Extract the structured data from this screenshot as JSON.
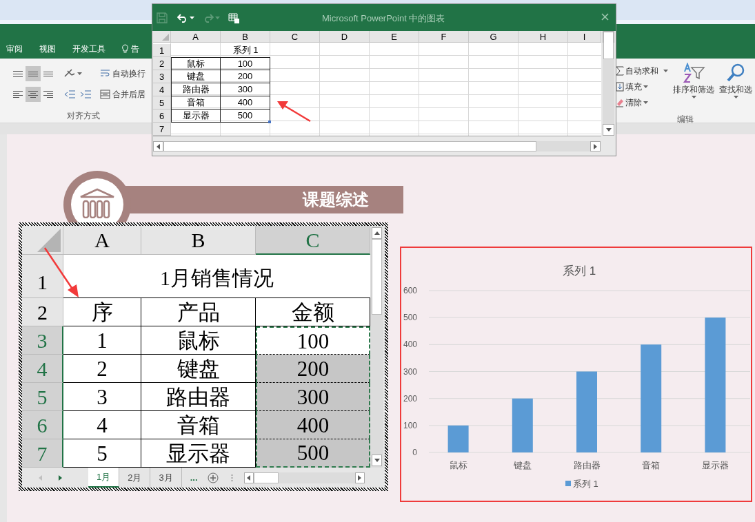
{
  "ribbon": {
    "tabs": [
      {
        "label": "审阅",
        "selected": false
      },
      {
        "label": "视图",
        "selected": false
      },
      {
        "label": "开发工具",
        "selected": false
      }
    ],
    "tell_me": "告",
    "alignment": {
      "vertical": [
        {
          "kind": "top",
          "selected": false
        },
        {
          "kind": "middle",
          "selected": true
        },
        {
          "kind": "bottom",
          "selected": false
        }
      ],
      "horizontal": [
        {
          "kind": "left",
          "selected": false
        },
        {
          "kind": "center",
          "selected": true
        },
        {
          "kind": "right",
          "selected": false
        }
      ],
      "wrap_text": "自动换行",
      "merge_center": "合并后居",
      "label": "对齐方式"
    },
    "editing": {
      "autosum": "自动求和",
      "fill": "填充",
      "clear": "清除",
      "sort_filter": "排序和筛选",
      "find_select": "查找和选",
      "label": "编辑"
    }
  },
  "data_window": {
    "title": "Microsoft PowerPoint 中的图表",
    "columns": [
      "A",
      "B",
      "C",
      "D",
      "E",
      "F",
      "G",
      "H",
      "I"
    ],
    "rows": [
      {
        "number": "1",
        "b": "系列 1"
      },
      {
        "number": "2",
        "a": "鼠标",
        "b": "100"
      },
      {
        "number": "3",
        "a": "键盘",
        "b": "200"
      },
      {
        "number": "4",
        "a": "路由器",
        "b": "300"
      },
      {
        "number": "5",
        "a": "音箱",
        "b": "400"
      },
      {
        "number": "6",
        "a": "显示器",
        "b": "500"
      },
      {
        "number": "7"
      }
    ]
  },
  "slide": {
    "banner": "课题综述",
    "sheet": {
      "columns": [
        {
          "label": "A",
          "selected": false
        },
        {
          "label": "B",
          "selected": false
        },
        {
          "label": "C",
          "selected": true
        }
      ],
      "title_row": {
        "number": "1",
        "text": "1月销售情况",
        "selected": false
      },
      "rows": [
        {
          "number": "2",
          "selected": false,
          "cells": [
            {
              "text": "序",
              "selected": false,
              "shaded": false
            },
            {
              "text": "产品",
              "selected": false,
              "shaded": false
            },
            {
              "text": "金额",
              "selected": false,
              "shaded": false
            }
          ]
        },
        {
          "number": "3",
          "selected": true,
          "cells": [
            {
              "text": "1",
              "selected": false,
              "shaded": false
            },
            {
              "text": "鼠标",
              "selected": false,
              "shaded": false
            },
            {
              "text": "100",
              "selected": true,
              "shaded": false
            }
          ]
        },
        {
          "number": "4",
          "selected": true,
          "cells": [
            {
              "text": "2",
              "selected": false,
              "shaded": false
            },
            {
              "text": "键盘",
              "selected": false,
              "shaded": false
            },
            {
              "text": "200",
              "selected": true,
              "shaded": true
            }
          ]
        },
        {
          "number": "5",
          "selected": true,
          "cells": [
            {
              "text": "3",
              "selected": false,
              "shaded": false
            },
            {
              "text": "路由器",
              "selected": false,
              "shaded": false
            },
            {
              "text": "300",
              "selected": true,
              "shaded": true
            }
          ]
        },
        {
          "number": "6",
          "selected": true,
          "cells": [
            {
              "text": "4",
              "selected": false,
              "shaded": false
            },
            {
              "text": "音箱",
              "selected": false,
              "shaded": false
            },
            {
              "text": "400",
              "selected": true,
              "shaded": true
            }
          ]
        },
        {
          "number": "7",
          "selected": true,
          "cells": [
            {
              "text": "5",
              "selected": false,
              "shaded": false
            },
            {
              "text": "显示器",
              "selected": false,
              "shaded": false
            },
            {
              "text": "500",
              "selected": true,
              "shaded": true
            }
          ]
        }
      ],
      "sheet_tabs": [
        {
          "label": "1月",
          "selected": true
        },
        {
          "label": "2月",
          "selected": false
        },
        {
          "label": "3月",
          "selected": false
        }
      ],
      "more_tabs": "..."
    },
    "chart": {
      "chart_data": {
        "type": "bar",
        "title": "系列 1",
        "categories": [
          "鼠标",
          "键盘",
          "路由器",
          "音箱",
          "显示器"
        ],
        "series": [
          {
            "name": "系列 1",
            "color": "#5b9bd5",
            "values": [
              100,
              200,
              300,
              400,
              500
            ]
          }
        ],
        "ylim": [
          0,
          600
        ],
        "grid": true,
        "yticks": [
          0,
          100,
          200,
          300,
          400,
          500,
          600
        ]
      }
    }
  }
}
